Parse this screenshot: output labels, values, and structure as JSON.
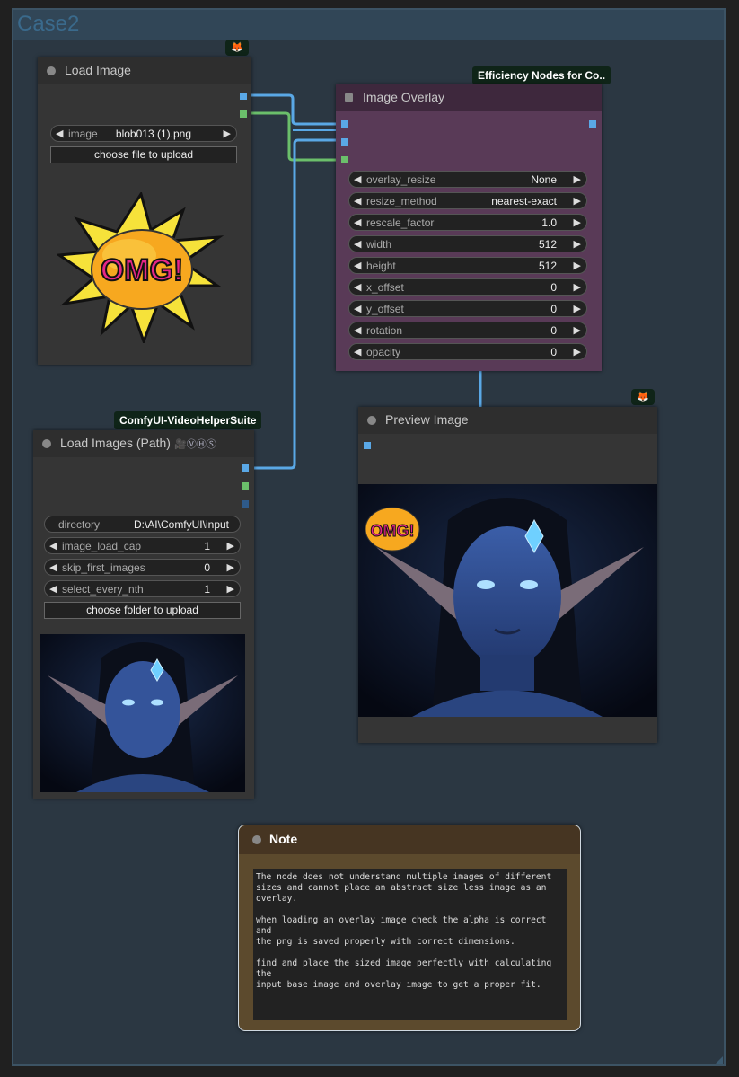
{
  "group": {
    "title": "Case2"
  },
  "badges": {
    "efficiency": "Efficiency Nodes for Co..",
    "videohelper": "ComfyUI-VideoHelperSuite",
    "fox_glyph": "🦊"
  },
  "load_image": {
    "title": "Load Image",
    "image_label": "image",
    "image_value": "blob013 (1).png",
    "upload_button": "choose file to upload",
    "preview_text": "OMG!"
  },
  "image_overlay": {
    "title": "Image Overlay",
    "widgets": [
      {
        "label": "overlay_resize",
        "value": "None"
      },
      {
        "label": "resize_method",
        "value": "nearest-exact"
      },
      {
        "label": "rescale_factor",
        "value": "1.0"
      },
      {
        "label": "width",
        "value": "512"
      },
      {
        "label": "height",
        "value": "512"
      },
      {
        "label": "x_offset",
        "value": "0"
      },
      {
        "label": "y_offset",
        "value": "0"
      },
      {
        "label": "rotation",
        "value": "0"
      },
      {
        "label": "opacity",
        "value": "0"
      }
    ]
  },
  "load_images_path": {
    "title": "Load Images (Path)",
    "title_icons": "🎥ⓋⒽⓈ",
    "directory_label": "directory",
    "directory_value": "D:\\AI\\ComfyUI\\input",
    "widgets": [
      {
        "label": "image_load_cap",
        "value": "1"
      },
      {
        "label": "skip_first_images",
        "value": "0"
      },
      {
        "label": "select_every_nth",
        "value": "1"
      }
    ],
    "upload_button": "choose folder to upload"
  },
  "preview_image": {
    "title": "Preview Image",
    "overlay_text": "OMG!"
  },
  "note": {
    "title": "Note",
    "text": "The node does not understand multiple images of different\nsizes and cannot place an abstract size less image as an\noverlay.\n\nwhen loading an overlay image check the alpha is correct and\nthe png is saved properly with correct dimensions.\n\nfind and place the sized image perfectly with calculating the\ninput base image and overlay image to get a proper fit."
  },
  "colors": {
    "group_bg": "#2b3742",
    "overlay_node_bg": "#593a57",
    "note_bg": "#5c4a2d",
    "socket_blue": "#5aa8e6",
    "socket_green": "#6bbf6b"
  }
}
